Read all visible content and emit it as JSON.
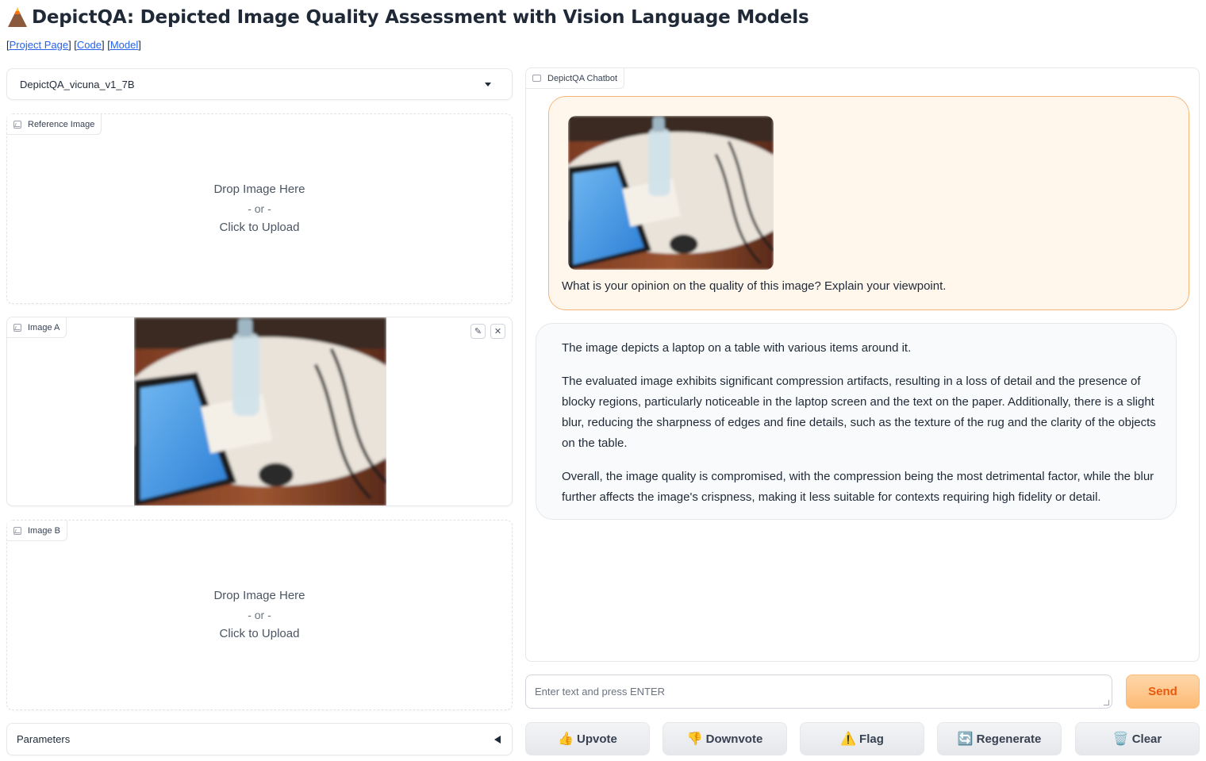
{
  "header": {
    "title": "DepictQA: Depicted Image Quality Assessment with Vision Language Models",
    "links": [
      {
        "label": "Project Page"
      },
      {
        "label": "Code"
      },
      {
        "label": "Model"
      }
    ]
  },
  "left": {
    "model_select": {
      "value": "DepictQA_vicuna_v1_7B"
    },
    "reference_image": {
      "label": "Reference Image",
      "drop_text": "Drop Image Here",
      "or_text": "- or -",
      "click_text": "Click to Upload"
    },
    "image_a": {
      "label": "Image A"
    },
    "image_b": {
      "label": "Image B",
      "drop_text": "Drop Image Here",
      "or_text": "- or -",
      "click_text": "Click to Upload"
    },
    "parameters": {
      "label": "Parameters"
    }
  },
  "chat": {
    "label": "DepictQA Chatbot",
    "user_message": "What is your opinion on the quality of this image? Explain your viewpoint.",
    "bot_paragraphs": [
      "The image depicts a laptop on a table with various items around it.",
      "The evaluated image exhibits significant compression artifacts, resulting in a loss of detail and the presence of blocky regions, particularly noticeable in the laptop screen and the text on the paper. Additionally, there is a slight blur, reducing the sharpness of edges and fine details, such as the texture of the rug and the clarity of the objects on the table.",
      "Overall, the image quality is compromised, with the compression being the most detrimental factor, while the blur further affects the image's crispness, making it less suitable for contexts requiring high fidelity or detail."
    ],
    "input": {
      "placeholder": "Enter text and press ENTER",
      "value": ""
    },
    "send_label": "Send"
  },
  "actions": [
    {
      "icon": "👍",
      "label": "Upvote"
    },
    {
      "icon": "👎",
      "label": "Downvote"
    },
    {
      "icon": "⚠️",
      "label": "Flag"
    },
    {
      "icon": "🔄",
      "label": "Regenerate"
    },
    {
      "icon": "🗑️",
      "label": "Clear"
    }
  ],
  "colors": {
    "accent": "#f97316",
    "user_bubble": "#fff7ec",
    "user_border": "#f5b47a"
  }
}
